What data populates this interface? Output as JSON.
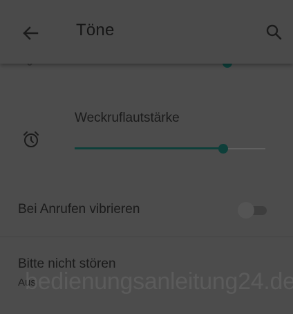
{
  "header": {
    "title": "Töne",
    "back_icon": "arrow-back-icon",
    "search_icon": "search-icon"
  },
  "volume_top": {
    "icon": "volume-icon",
    "level": 0.8
  },
  "alarm_volume": {
    "label": "Weckruflautstärke",
    "icon": "alarm-clock-icon",
    "level": 0.78
  },
  "vibrate_on_call": {
    "label": "Bei Anrufen vibrieren",
    "enabled": false
  },
  "do_not_disturb": {
    "title": "Bitte nicht stören",
    "status": "Aus"
  },
  "watermark": "bedienungsanleitung24.de",
  "colors": {
    "background": "#4c4c4c",
    "accent": "#0e3f3a",
    "text": "#1a1a1a"
  }
}
